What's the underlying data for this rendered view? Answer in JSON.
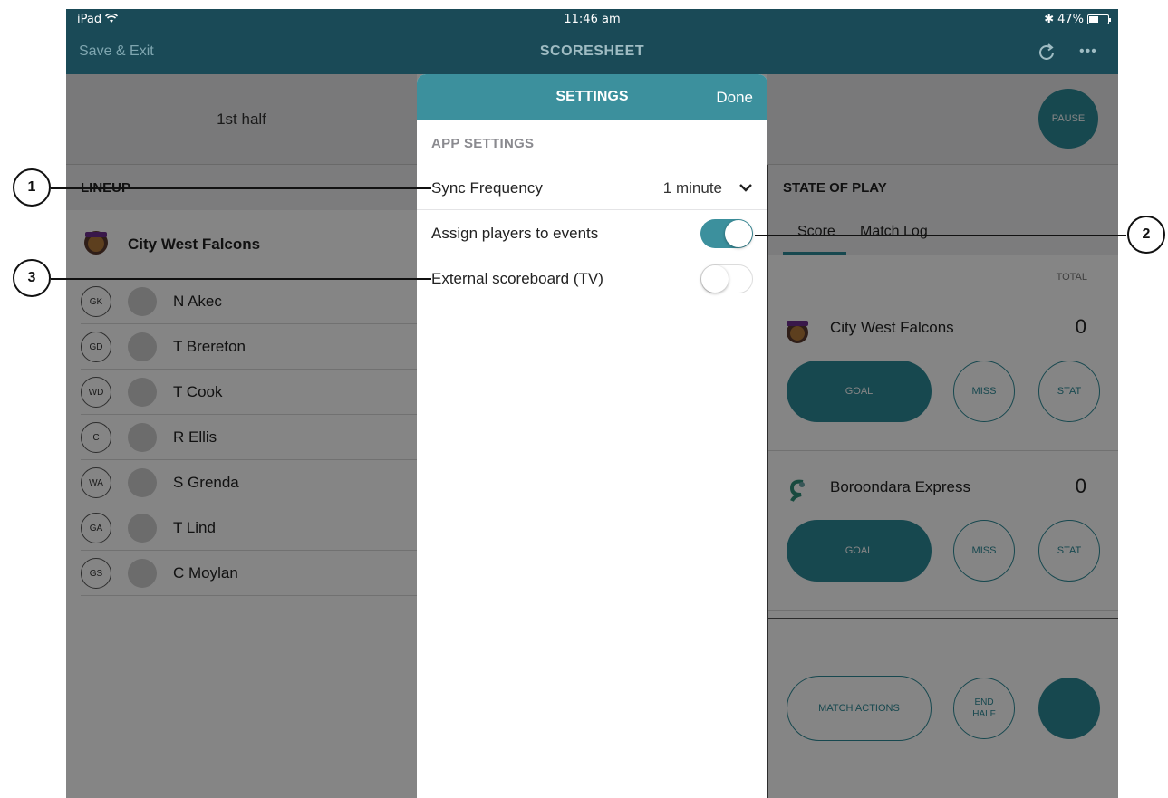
{
  "status_bar": {
    "device": "iPad",
    "time": "11:46 am",
    "battery": "47%",
    "battery_level": 0.47
  },
  "nav": {
    "left": "Save & Exit",
    "title": "SCORESHEET",
    "more": "•••",
    "refresh_icon": "refresh-icon"
  },
  "period": {
    "label": "1st half",
    "pause": "PAUSE"
  },
  "lineup": {
    "header": "LINEUP",
    "team": "City West Falcons",
    "players": [
      {
        "pos": "GK",
        "name": "N Akec"
      },
      {
        "pos": "GD",
        "name": "T Brereton"
      },
      {
        "pos": "WD",
        "name": "T Cook"
      },
      {
        "pos": "C",
        "name": "R Ellis"
      },
      {
        "pos": "WA",
        "name": "S Grenda"
      },
      {
        "pos": "GA",
        "name": "T Lind"
      },
      {
        "pos": "GS",
        "name": "C Moylan"
      }
    ]
  },
  "state_of_play": {
    "header": "STATE OF PLAY",
    "tabs": [
      "Score",
      "Match Log"
    ],
    "total_label": "TOTAL",
    "teams": [
      {
        "name": "City West Falcons",
        "score": "0",
        "goal": "GOAL",
        "miss": "MISS",
        "stat": "STAT"
      },
      {
        "name": "Boroondara Express",
        "score": "0",
        "goal": "GOAL",
        "miss": "MISS",
        "stat": "STAT"
      }
    ],
    "match_actions": "MATCH ACTIONS",
    "end_half": "END\nHALF"
  },
  "settings": {
    "title": "SETTINGS",
    "done": "Done",
    "section": "APP SETTINGS",
    "sync_label": "Sync Frequency",
    "sync_value": "1 minute",
    "assign_label": "Assign players to events",
    "assign_on": true,
    "external_label": "External scoreboard (TV)",
    "external_on": false
  },
  "callouts": [
    "1",
    "2",
    "3"
  ],
  "colors": {
    "nav": "#1a4a57",
    "accent": "#3c909d",
    "teal": "#2d8a97"
  }
}
